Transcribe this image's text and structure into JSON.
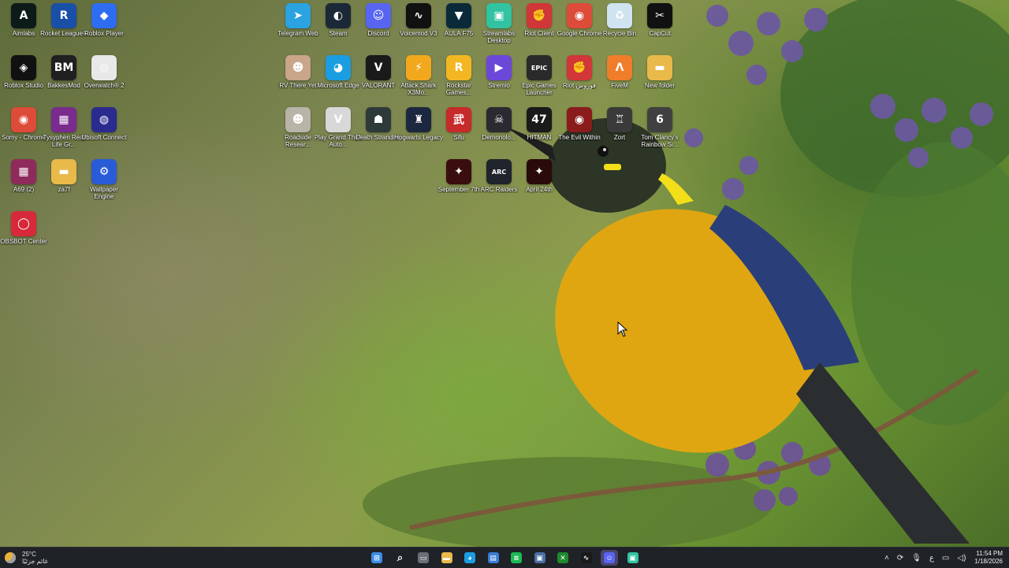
{
  "desktop": {
    "icons_left": [
      {
        "label": "Aimlabs",
        "icon": "aimlabs-icon",
        "color": "#0c1a1a",
        "glyph": "A"
      },
      {
        "label": "Rocket League®",
        "icon": "rocket-league-icon",
        "color": "#1a4fa8",
        "glyph": "R"
      },
      {
        "label": "Roblox Player",
        "icon": "roblox-icon",
        "color": "#2f6df0",
        "glyph": "◆"
      },
      {
        "label": "Roblox Studio",
        "icon": "roblox-studio-icon",
        "color": "#111111",
        "glyph": "◈"
      },
      {
        "label": "BakkesMod",
        "icon": "bakkesmod-icon",
        "color": "#202020",
        "glyph": "BM"
      },
      {
        "label": "Overwatch® 2",
        "icon": "overwatch-icon",
        "color": "#e8e8e8",
        "glyph": "◎"
      },
      {
        "label": "Somy - Chrome",
        "icon": "chrome-icon",
        "color": "#dd4b39",
        "glyph": "◉"
      },
      {
        "label": "Tysyphen Real Life Gr...",
        "icon": "winrar-icon",
        "color": "#7a2b8e",
        "glyph": "▦"
      },
      {
        "label": "Ubisoft Connect",
        "icon": "ubisoft-icon",
        "color": "#2b2b8f",
        "glyph": "◍"
      },
      {
        "label": "A69 (2)",
        "icon": "winrar-archive-icon",
        "color": "#8e2b5a",
        "glyph": "▦"
      },
      {
        "label": "za7f",
        "icon": "folder-icon",
        "color": "#e9b94a",
        "glyph": "▬"
      },
      {
        "label": "Wallpaper Engine",
        "icon": "wallpaper-engine-icon",
        "color": "#2a5bd7",
        "glyph": "⚙"
      },
      {
        "label": "OBSBOT Center",
        "icon": "obsbot-icon",
        "color": "#d62a3a",
        "glyph": "◯"
      }
    ],
    "icons_top": [
      {
        "label": "Telegram Web",
        "icon": "telegram-icon",
        "color": "#2aa3e0",
        "glyph": "➤"
      },
      {
        "label": "Steam",
        "icon": "steam-icon",
        "color": "#1b2838",
        "glyph": "◐"
      },
      {
        "label": "Discord",
        "icon": "discord-icon",
        "color": "#5865f2",
        "glyph": "☺"
      },
      {
        "label": "Voicemod V3",
        "icon": "voicemod-icon",
        "color": "#111111",
        "glyph": "∿"
      },
      {
        "label": "AULA F75",
        "icon": "aula-icon",
        "color": "#0a2a3a",
        "glyph": "▼"
      },
      {
        "label": "Streamlabs Desktop",
        "icon": "streamlabs-icon",
        "color": "#31c3a2",
        "glyph": "▣"
      },
      {
        "label": "Riot Client",
        "icon": "riot-client-icon",
        "color": "#d13639",
        "glyph": "✊"
      },
      {
        "label": "Google Chrome",
        "icon": "chrome-icon",
        "color": "#dd4b39",
        "glyph": "◉"
      },
      {
        "label": "Recycle Bin",
        "icon": "recycle-bin-icon",
        "color": "#cfe3f0",
        "glyph": "♻"
      },
      {
        "label": "CapCut",
        "icon": "capcut-icon",
        "color": "#111111",
        "glyph": "✂"
      },
      {
        "label": "RV There Yet",
        "icon": "rv-there-yet-icon",
        "color": "#c9a58a",
        "glyph": "☻"
      },
      {
        "label": "Microsoft Edge",
        "icon": "edge-icon",
        "color": "#1b9de2",
        "glyph": "◕"
      },
      {
        "label": "VALORANT",
        "icon": "valorant-icon",
        "color": "#1a1a1a",
        "glyph": "V"
      },
      {
        "label": "Attack Shark X3Mo...",
        "icon": "attack-shark-icon",
        "color": "#f2a81d",
        "glyph": "⚡"
      },
      {
        "label": "Rockstar Games...",
        "icon": "rockstar-icon",
        "color": "#f3b723",
        "glyph": "R"
      },
      {
        "label": "Stremio",
        "icon": "stremio-icon",
        "color": "#6c48d8",
        "glyph": "▶"
      },
      {
        "label": "Epic Games Launcher",
        "icon": "epic-games-icon",
        "color": "#2a2a2a",
        "glyph": "EPIC"
      },
      {
        "label": "Riot فوروش",
        "icon": "riot-icon",
        "color": "#d13639",
        "glyph": "✊"
      },
      {
        "label": "FiveM",
        "icon": "fivem-icon",
        "color": "#f07d2a",
        "glyph": "Λ"
      },
      {
        "label": "New folder",
        "icon": "folder-icon",
        "color": "#e9b94a",
        "glyph": "▬"
      },
      {
        "label": "Roadside Resear...",
        "icon": "roadside-icon",
        "color": "#b9b4a8",
        "glyph": "☻"
      },
      {
        "label": "Play Grand Theft Auto...",
        "icon": "gta-icon",
        "color": "#d8d8d8",
        "glyph": "V"
      },
      {
        "label": "Death Stranding",
        "icon": "death-stranding-icon",
        "color": "#2e3a3a",
        "glyph": "☗"
      },
      {
        "label": "Hogwarts Legacy",
        "icon": "hogwarts-icon",
        "color": "#1c2840",
        "glyph": "♜"
      },
      {
        "label": "Sifu",
        "icon": "sifu-icon",
        "color": "#c62a2a",
        "glyph": "武"
      },
      {
        "label": "Demonolo...",
        "icon": "demonologist-icon",
        "color": "#2a2a30",
        "glyph": "☠"
      },
      {
        "label": "HITMAN",
        "icon": "hitman-icon",
        "color": "#1a1a1a",
        "glyph": "47"
      },
      {
        "label": "The Evil Within",
        "icon": "evil-within-icon",
        "color": "#8a1c1c",
        "glyph": "◉"
      },
      {
        "label": "Zort",
        "icon": "zort-icon",
        "color": "#3a3a3a",
        "glyph": "♖"
      },
      {
        "label": "Tom Clancy's Rainbow Si...",
        "icon": "rainbow-six-icon",
        "color": "#404040",
        "glyph": "6"
      },
      {
        "label": "September 7th",
        "icon": "september-7th-icon",
        "color": "#3a0e0e",
        "glyph": "✦"
      },
      {
        "label": "ARC Raiders",
        "icon": "arc-raiders-icon",
        "color": "#20242c",
        "glyph": "ARC"
      },
      {
        "label": "April 24th",
        "icon": "april-24th-icon",
        "color": "#2a0a0a",
        "glyph": "✦"
      }
    ]
  },
  "taskbar": {
    "weather_temp": "25°C",
    "weather_desc": "غائم جزئيًا",
    "apps": [
      {
        "name": "start-button",
        "icon": "windows-icon",
        "color": "#3d8ee8",
        "glyph": "⊞",
        "active": false
      },
      {
        "name": "taskbar-search",
        "icon": "search-icon",
        "color": "transparent",
        "glyph": "⌕",
        "active": false
      },
      {
        "name": "taskbar-task-view",
        "icon": "task-view-icon",
        "color": "#6a6f77",
        "glyph": "▭",
        "active": false
      },
      {
        "name": "taskbar-file-explorer",
        "icon": "folder-icon",
        "color": "#e9b94a",
        "glyph": "▬",
        "active": false
      },
      {
        "name": "taskbar-edge",
        "icon": "edge-icon",
        "color": "#1b9de2",
        "glyph": "◕",
        "active": false
      },
      {
        "name": "taskbar-store",
        "icon": "store-icon",
        "color": "#3a7bd5",
        "glyph": "▤",
        "active": false
      },
      {
        "name": "taskbar-spotify",
        "icon": "spotify-icon",
        "color": "#1db954",
        "glyph": "≋",
        "active": false
      },
      {
        "name": "taskbar-app",
        "icon": "app-window-icon",
        "color": "#4a6fa5",
        "glyph": "▣",
        "active": false
      },
      {
        "name": "taskbar-xbox",
        "icon": "xbox-icon",
        "color": "#1e8a2f",
        "glyph": "✕",
        "active": false
      },
      {
        "name": "taskbar-voicemod",
        "icon": "voicemod-icon",
        "color": "#1a1a1a",
        "glyph": "∿",
        "active": false
      },
      {
        "name": "taskbar-discord",
        "icon": "discord-icon",
        "color": "#5865f2",
        "glyph": "☺",
        "active": true
      },
      {
        "name": "taskbar-streamlabs",
        "icon": "streamlabs-icon",
        "color": "#31c3a2",
        "glyph": "▣",
        "active": false
      }
    ],
    "tray_lang": "ع",
    "time": "11:54 PM",
    "date": "1/18/2026"
  }
}
